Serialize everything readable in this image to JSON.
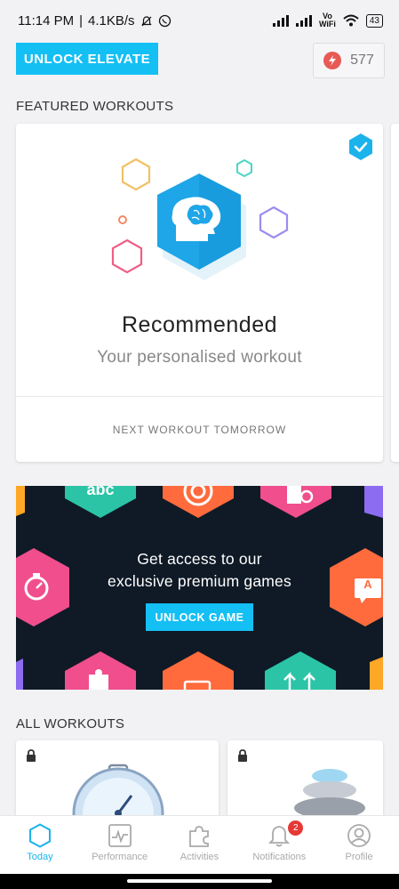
{
  "status_bar": {
    "time": "11:14 PM",
    "speed": "4.1KB/s",
    "volte": "Vo",
    "wifi_label": "WiFi",
    "battery": "43"
  },
  "header": {
    "unlock_label": "UNLOCK ELEVATE",
    "streak_count": "577",
    "streak_icon": "lightning-icon",
    "accent_color": "#14bff4"
  },
  "featured": {
    "section_title": "FEATURED WORKOUTS",
    "card": {
      "title": "Recommended",
      "subtitle": "Your personalised workout",
      "footer": "NEXT WORKOUT TOMORROW",
      "icon": "brain-hexagon-icon"
    }
  },
  "promo": {
    "headline_line1": "Get access to our",
    "headline_line2": "exclusive premium games",
    "button_label": "UNLOCK GAME",
    "tile_text": "abc"
  },
  "all_workouts": {
    "section_title": "ALL WORKOUTS"
  },
  "tabs": [
    {
      "label": "Today",
      "icon": "hexagon-icon",
      "active": true
    },
    {
      "label": "Performance",
      "icon": "chart-icon",
      "active": false
    },
    {
      "label": "Activities",
      "icon": "puzzle-icon",
      "active": false
    },
    {
      "label": "Notifications",
      "icon": "bell-icon",
      "active": false,
      "badge": "2"
    },
    {
      "label": "Profile",
      "icon": "user-icon",
      "active": false
    }
  ]
}
